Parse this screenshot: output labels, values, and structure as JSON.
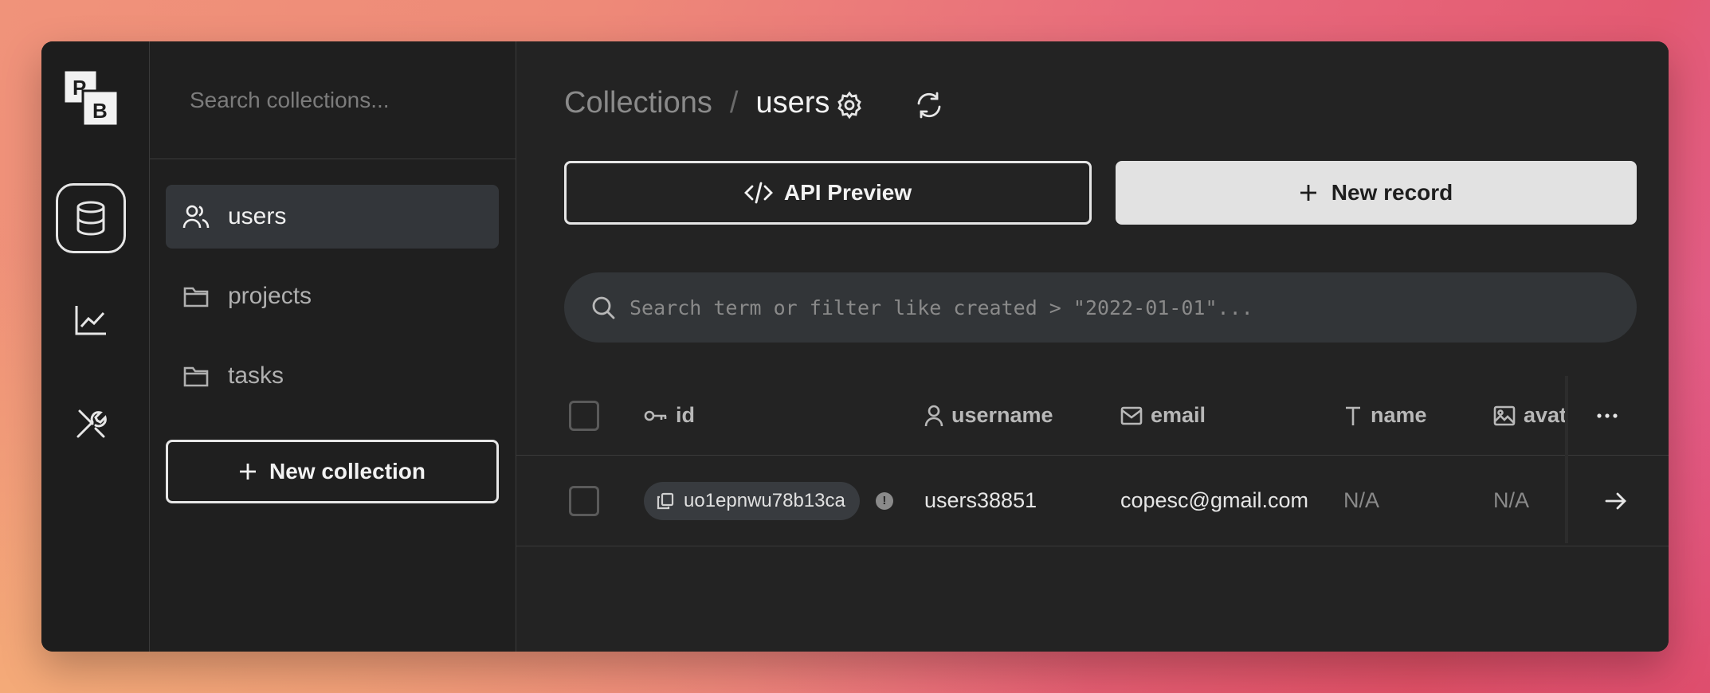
{
  "brand": {
    "logo_letters": [
      "P",
      "B"
    ]
  },
  "rail": {
    "items": [
      {
        "icon": "database-icon",
        "active": true
      },
      {
        "icon": "chart-icon",
        "active": false
      },
      {
        "icon": "tools-icon",
        "active": false
      }
    ]
  },
  "sidebar": {
    "search_placeholder": "Search collections...",
    "items": [
      {
        "label": "users",
        "icon": "users-icon",
        "active": true
      },
      {
        "label": "projects",
        "icon": "folder-icon",
        "active": false
      },
      {
        "label": "tasks",
        "icon": "folder-icon",
        "active": false
      }
    ],
    "new_collection_label": "New collection"
  },
  "header": {
    "breadcrumb_parent": "Collections",
    "breadcrumb_separator": "/",
    "breadcrumb_current": "users",
    "settings_icon": "gear-icon",
    "refresh_icon": "refresh-icon"
  },
  "actions": {
    "api_preview_label": "API Preview",
    "new_record_label": "New record"
  },
  "search": {
    "placeholder": "Search term or filter like created > \"2022-01-01\"..."
  },
  "table": {
    "columns": [
      {
        "label": "id",
        "icon": "key-icon"
      },
      {
        "label": "username",
        "icon": "user-icon"
      },
      {
        "label": "email",
        "icon": "mail-icon"
      },
      {
        "label": "name",
        "icon": "text-icon"
      },
      {
        "label": "avata",
        "icon": "image-icon"
      }
    ],
    "more_icon": "more-horizontal-icon",
    "rows": [
      {
        "id": "uo1epnwu78b13ca",
        "username": "users38851",
        "email": "copesc@gmail.com",
        "name": "N/A",
        "avatar": "N/A"
      }
    ]
  },
  "colors": {
    "window_bg": "#232323",
    "sidebar_bg": "#1f1f1f",
    "active_item_bg": "#33363a",
    "primary_button_bg": "#e2e2e2",
    "text_primary": "#f2f2f2",
    "text_muted": "#8a8a8a"
  }
}
